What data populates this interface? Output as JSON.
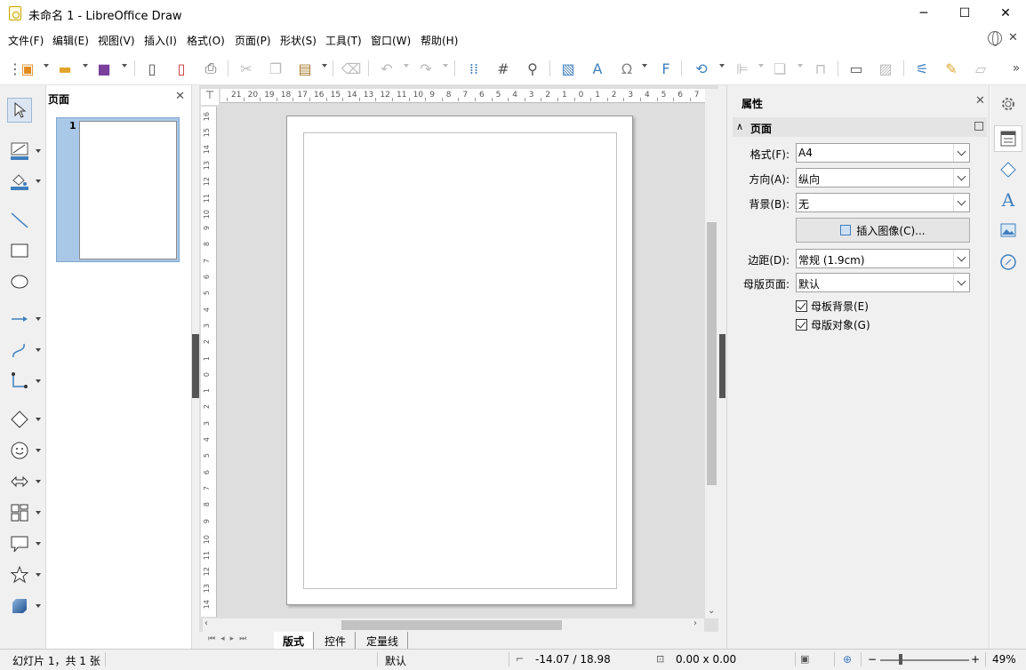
{
  "window": {
    "title": "未命名 1 - LibreOffice Draw",
    "minimize": "─",
    "maximize": "☐",
    "close": "✕"
  },
  "menu": [
    "文件(F)",
    "编辑(E)",
    "视图(V)",
    "插入(I)",
    "格式(O)",
    "页面(P)",
    "形状(S)",
    "工具(T)",
    "窗口(W)",
    "帮助(H)"
  ],
  "pages_panel": {
    "title": "页面",
    "close": "✕",
    "thumbnails": [
      {
        "number": "1"
      }
    ]
  },
  "ruler": {
    "h_labels": [
      "21",
      "20",
      "19",
      "18",
      "17",
      "16",
      "15",
      "14",
      "13",
      "12",
      "11",
      "10",
      "9",
      "8",
      "7",
      "6",
      "5",
      "4",
      "3",
      "2",
      "1",
      "0",
      "1",
      "2",
      "3",
      "4",
      "5",
      "6",
      "7"
    ],
    "v_labels": [
      "16",
      "15",
      "14",
      "13",
      "12",
      "11",
      "10",
      "9",
      "8",
      "7",
      "6",
      "5",
      "4",
      "3",
      "2",
      "1",
      "0",
      "1",
      "2",
      "3",
      "4",
      "5",
      "6",
      "7",
      "8",
      "9",
      "10",
      "11",
      "12",
      "13",
      "14"
    ]
  },
  "tabs": [
    {
      "label": "版式",
      "active": true
    },
    {
      "label": "控件",
      "active": false
    },
    {
      "label": "定量线",
      "active": false
    }
  ],
  "properties": {
    "title": "属性",
    "close": "✕",
    "section": "页面",
    "format_label": "格式(F):",
    "format_value": "A4",
    "orientation_label": "方向(A):",
    "orientation_value": "纵向",
    "background_label": "背景(B):",
    "background_value": "无",
    "insert_image_button": "插入图像(C)...",
    "margins_label": "边距(D):",
    "margins_value": "常规 (1.9cm)",
    "master_label": "母版页面:",
    "master_value": "默认",
    "master_background": "母板背景(E)",
    "master_objects": "母版对象(G)"
  },
  "status": {
    "slide": "幻灯片 1，共 1 张",
    "master": "默认",
    "position": "-14.07 / 18.98",
    "size": "0.00 x 0.00",
    "zoom": "49%"
  },
  "colors": {
    "accent": "#3f7fbf",
    "save": "#7a3f9b",
    "thumb_selection": "#a9c8e8"
  }
}
